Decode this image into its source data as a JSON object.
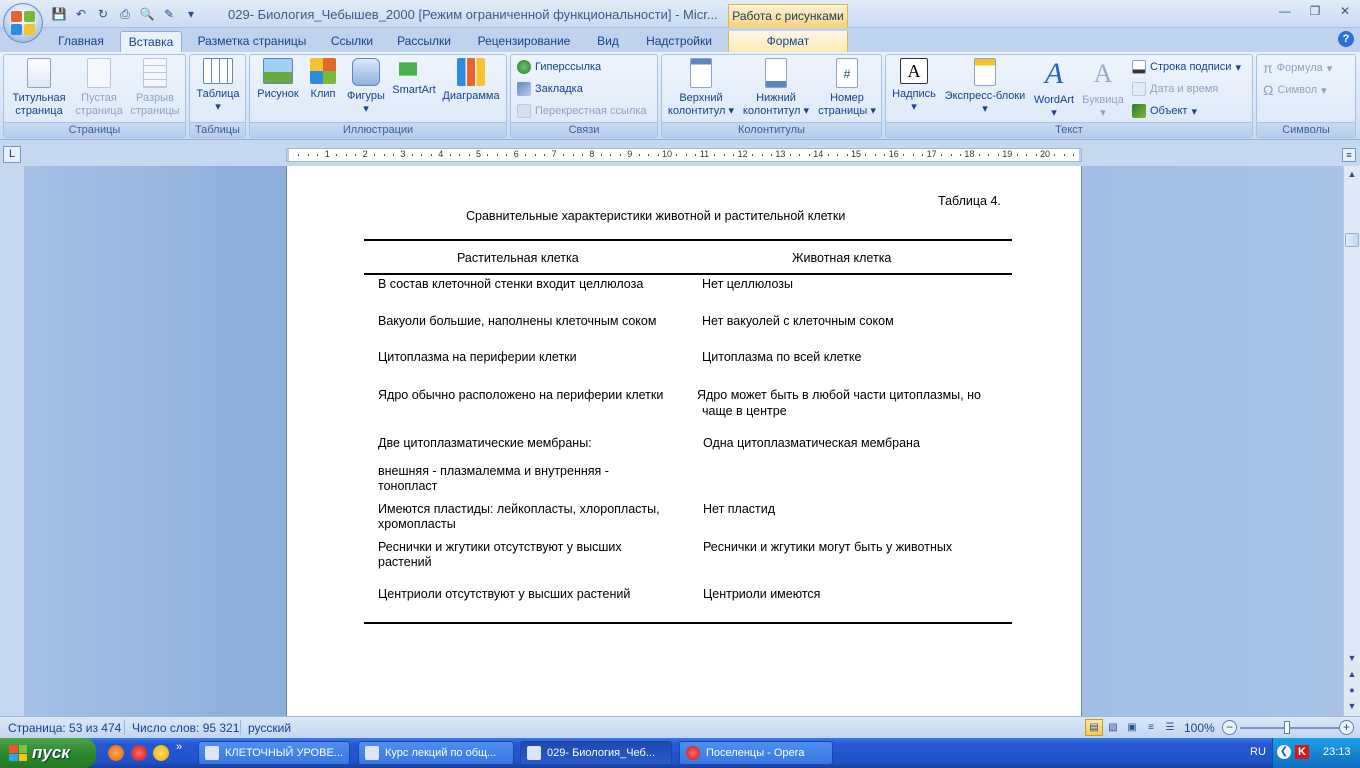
{
  "window": {
    "title": "029- Биология_Чебышев_2000 [Режим ограниченной функциональности] - Micr...",
    "context_tab_header": "Работа с рисунками"
  },
  "tabs": [
    "Главная",
    "Вставка",
    "Разметка страницы",
    "Ссылки",
    "Рассылки",
    "Рецензирование",
    "Вид",
    "Надстройки",
    "Формат"
  ],
  "active_tab": "Вставка",
  "ribbon": {
    "groups": {
      "pages": "Страницы",
      "tables": "Таблицы",
      "illustrations": "Иллюстрации",
      "links": "Связи",
      "headers": "Колонтитулы",
      "text": "Текст",
      "symbols": "Символы"
    },
    "buttons": {
      "cover_page_1": "Титульная",
      "cover_page_2": "страница",
      "blank_page_1": "Пустая",
      "blank_page_2": "страница",
      "page_break_1": "Разрыв",
      "page_break_2": "страницы",
      "table": "Таблица",
      "picture": "Рисунок",
      "clip": "Клип",
      "shapes": "Фигуры",
      "smartart": "SmartArt",
      "chart": "Диаграмма",
      "hyperlink": "Гиперссылка",
      "bookmark": "Закладка",
      "crossref": "Перекрестная ссылка",
      "header_1": "Верхний",
      "header_2": "колонтитул",
      "footer_1": "Нижний",
      "footer_2": "колонтитул",
      "page_number_1": "Номер",
      "page_number_2": "страницы",
      "textbox": "Надпись",
      "quickparts": "Экспресс-блоки",
      "wordart": "WordArt",
      "dropcap": "Буквица",
      "signature_line": "Строка подписи",
      "date_time": "Дата и время",
      "object": "Объект",
      "equation": "Формула",
      "symbol": "Символ"
    }
  },
  "document": {
    "table_number": "Таблица  4.",
    "table_title": "Сравнительные  характеристики  животной  и растительной  клетки",
    "headers": [
      "Растительная клетка",
      "Животная клетка"
    ],
    "rows": [
      {
        "plant": [
          "В состав клеточной стенки входит целлюлоза"
        ],
        "animal": [
          "Нет целлюлозы"
        ]
      },
      {
        "plant": [
          "Вакуоли большие, наполнены клеточным соком"
        ],
        "animal": [
          "Нет вакуолей с клеточным соком"
        ]
      },
      {
        "plant": [
          "Цитоплазма на периферии клетки"
        ],
        "animal": [
          "Цитоплазма по всей клетке"
        ]
      },
      {
        "plant": [
          "Ядро обычно расположено на периферии клетки"
        ],
        "animal": [
          "Ядро может быть в любой части цитоплазмы,  но",
          "чаще в центре"
        ]
      },
      {
        "plant": [
          "Две цитоплазматические мембраны:"
        ],
        "animal": [
          "Одна цитоплазматическая мембрана"
        ]
      },
      {
        "plant": [
          "внешняя  -  плазмалемма  и  внутренняя  -",
          "тонопласт"
        ],
        "animal": []
      },
      {
        "plant": [
          "Имеются  пластиды:  лейкопласты,  хлоропласты,",
          "хромопласты"
        ],
        "animal": [
          "Нет пластид"
        ]
      },
      {
        "plant": [
          "Реснички  и  жгутики  отсутствуют  у  высших",
          "растений"
        ],
        "animal": [
          "Реснички и жгутики могут быть у животных"
        ]
      },
      {
        "plant": [
          "Центриоли отсутствуют у высших растений"
        ],
        "animal": [
          "Центриоли имеются"
        ]
      }
    ]
  },
  "ruler_numbers": [
    "1",
    "2",
    "3",
    "4",
    "5",
    "6",
    "7",
    "8",
    "9",
    "10",
    "11",
    "12",
    "13",
    "14",
    "15",
    "16",
    "17",
    "18",
    "19",
    "20"
  ],
  "statusbar": {
    "page": "Страница: 53 из 474",
    "words": "Число слов: 95 321",
    "language": "русский",
    "zoom": "100%"
  },
  "taskbar": {
    "start": "пуск",
    "tasks": [
      "КЛЕТОЧНЫЙ УРОВЕ...",
      "Курс лекций по общ...",
      "029- Биология_Чеб...",
      "Поселенцы - Opera"
    ],
    "active_task": 2,
    "lang": "RU",
    "time": "23:13"
  },
  "colors": {
    "ribbon_text": "#15428b",
    "context_tab": "#f7d27a",
    "taskbar": "#2458d3",
    "start_button": "#2d8a2d"
  }
}
